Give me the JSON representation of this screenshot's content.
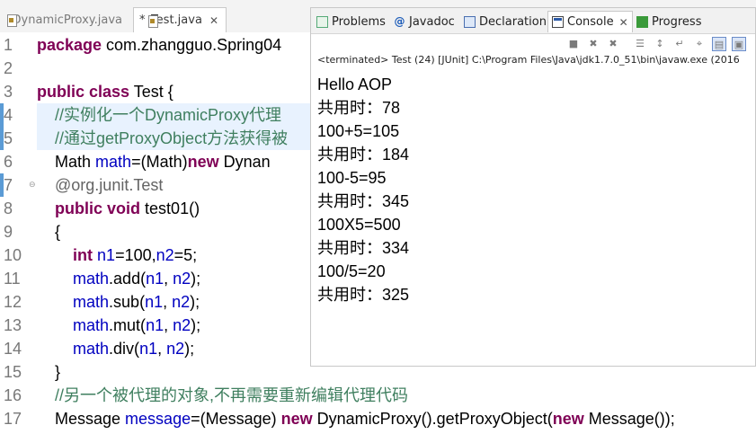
{
  "editor_tabs": [
    {
      "label": "DynamicProxy.java",
      "dirty": "",
      "active": false
    },
    {
      "label": "Test.java",
      "dirty": "*",
      "active": true,
      "close": "✕"
    }
  ],
  "code_lines": [
    {
      "number": "1",
      "tokens": [
        {
          "t": "package",
          "c": "kw"
        },
        {
          "t": " com.zhangguo.Spring04"
        }
      ]
    },
    {
      "number": "2",
      "tokens": []
    },
    {
      "number": "3",
      "tokens": [
        {
          "t": "public",
          "c": "kw"
        },
        {
          "t": " "
        },
        {
          "t": "class",
          "c": "kw"
        },
        {
          "t": " Test {"
        }
      ]
    },
    {
      "number": "4",
      "tokens": [
        {
          "t": "    "
        },
        {
          "t": "//实例化一个DynamicProxy代理",
          "c": "cm"
        }
      ]
    },
    {
      "number": "5",
      "tokens": [
        {
          "t": "    "
        },
        {
          "t": "//通过getProxyObject方法获得被",
          "c": "cm"
        }
      ]
    },
    {
      "number": "6",
      "tokens": [
        {
          "t": "    Math "
        },
        {
          "t": "math",
          "c": "var"
        },
        {
          "t": "=(Math)"
        },
        {
          "t": "new",
          "c": "kw"
        },
        {
          "t": " Dynan"
        }
      ]
    },
    {
      "number": "7",
      "marker": "⊖",
      "tokens": [
        {
          "t": "    "
        },
        {
          "t": "@org.junit.",
          "c": "ann"
        },
        {
          "t": "Test",
          "c": "ann"
        }
      ]
    },
    {
      "number": "8",
      "tokens": [
        {
          "t": "    "
        },
        {
          "t": "public",
          "c": "kw"
        },
        {
          "t": " "
        },
        {
          "t": "void",
          "c": "kw"
        },
        {
          "t": " test01()"
        }
      ]
    },
    {
      "number": "9",
      "tokens": [
        {
          "t": "    {"
        }
      ]
    },
    {
      "number": "10",
      "tokens": [
        {
          "t": "        "
        },
        {
          "t": "int",
          "c": "kw"
        },
        {
          "t": " "
        },
        {
          "t": "n1",
          "c": "var"
        },
        {
          "t": "=100,"
        },
        {
          "t": "n2",
          "c": "var"
        },
        {
          "t": "=5;"
        }
      ]
    },
    {
      "number": "11",
      "tokens": [
        {
          "t": "        "
        },
        {
          "t": "math",
          "c": "var"
        },
        {
          "t": ".add("
        },
        {
          "t": "n1",
          "c": "var"
        },
        {
          "t": ", "
        },
        {
          "t": "n2",
          "c": "var"
        },
        {
          "t": ");"
        }
      ]
    },
    {
      "number": "12",
      "tokens": [
        {
          "t": "        "
        },
        {
          "t": "math",
          "c": "var"
        },
        {
          "t": ".sub("
        },
        {
          "t": "n1",
          "c": "var"
        },
        {
          "t": ", "
        },
        {
          "t": "n2",
          "c": "var"
        },
        {
          "t": ");"
        }
      ]
    },
    {
      "number": "13",
      "tokens": [
        {
          "t": "        "
        },
        {
          "t": "math",
          "c": "var"
        },
        {
          "t": ".mut("
        },
        {
          "t": "n1",
          "c": "var"
        },
        {
          "t": ", "
        },
        {
          "t": "n2",
          "c": "var"
        },
        {
          "t": ");"
        }
      ]
    },
    {
      "number": "14",
      "tokens": [
        {
          "t": "        "
        },
        {
          "t": "math",
          "c": "var"
        },
        {
          "t": ".div("
        },
        {
          "t": "n1",
          "c": "var"
        },
        {
          "t": ", "
        },
        {
          "t": "n2",
          "c": "var"
        },
        {
          "t": ");"
        }
      ]
    },
    {
      "number": "15",
      "tokens": [
        {
          "t": "    }"
        }
      ]
    },
    {
      "number": "16",
      "tokens": [
        {
          "t": "    "
        },
        {
          "t": "//另一个被代理的对象,不再需要重新编辑代理代码",
          "c": "cm"
        }
      ]
    },
    {
      "number": "17",
      "tokens": [
        {
          "t": "    Message "
        },
        {
          "t": "message",
          "c": "var"
        },
        {
          "t": "=(Message) "
        },
        {
          "t": "new",
          "c": "kw"
        },
        {
          "t": " DynamicProxy().getProxyObject("
        },
        {
          "t": "new",
          "c": "kw"
        },
        {
          "t": " Message());"
        }
      ]
    }
  ],
  "view_tabs": [
    {
      "label": "Problems",
      "icon": "problems-icon"
    },
    {
      "label": "Javadoc",
      "icon": "javadoc-icon",
      "glyph": "@"
    },
    {
      "label": "Declaration",
      "icon": "declaration-icon"
    },
    {
      "label": "Console",
      "icon": "console-icon",
      "active": true,
      "close": "✕"
    },
    {
      "label": "Progress",
      "icon": "progress-icon"
    }
  ],
  "console_toolbar": [
    {
      "name": "terminate-icon",
      "glyph": "■"
    },
    {
      "name": "remove-launch-icon",
      "glyph": "✖"
    },
    {
      "name": "remove-all-icon",
      "glyph": "✖"
    },
    {
      "name": "clear-console-icon",
      "glyph": "☰"
    },
    {
      "name": "scroll-lock-icon",
      "glyph": "↕"
    },
    {
      "name": "word-wrap-icon",
      "glyph": "↵"
    },
    {
      "name": "pin-console-icon",
      "glyph": "⌖"
    },
    {
      "name": "display-selected-console-icon",
      "glyph": "▤",
      "pressed": true
    },
    {
      "name": "open-console-icon",
      "glyph": "▣",
      "pressed": true
    }
  ],
  "console_status": "<terminated> Test (24) [JUnit] C:\\Program Files\\Java\\jdk1.7.0_51\\bin\\javaw.exe (2016",
  "console_output": [
    "Hello AOP",
    "共用时：78",
    "100+5=105",
    "共用时：184",
    "100-5=95",
    "共用时：345",
    "100X5=500",
    "共用时：334",
    "100/5=20",
    "共用时：325"
  ]
}
